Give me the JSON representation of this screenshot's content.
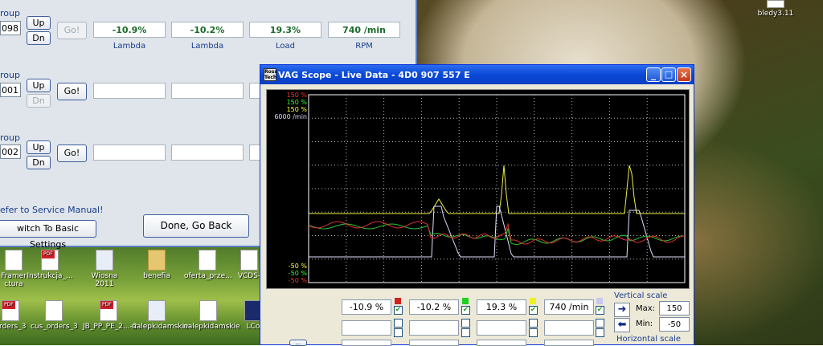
{
  "desktop": {
    "top_right_icon": {
      "label": "bledy3.11",
      "icon": "file-icon"
    },
    "icons": [
      {
        "label": "Framer\nctura",
        "icon": "document-icon"
      },
      {
        "label": "Instrukcja_...",
        "icon": "pdf-icon"
      },
      {
        "label": "Wiosna 2011",
        "icon": "odf-icon"
      },
      {
        "label": "benefia",
        "icon": "folder-icon"
      },
      {
        "label": "oferta_prze...",
        "icon": "document-icon"
      },
      {
        "label": "VCDS-",
        "icon": "shortcut-icon"
      },
      {
        "label": "orders_3",
        "icon": "pdf-icon"
      },
      {
        "label": "cus_orders_3",
        "icon": "document-icon"
      },
      {
        "label": "JB_PP_PE_2...-2",
        "icon": "pdf-icon"
      },
      {
        "label": "nalepkidamskie",
        "icon": "odf-icon"
      },
      {
        "label": "nalepkidamskie",
        "icon": "document-icon"
      },
      {
        "label": "LCo",
        "icon": "app-icon"
      }
    ]
  },
  "vcds": {
    "groups": [
      {
        "label": "roup",
        "number": "098",
        "up": "Up",
        "dn": "Dn",
        "go": "Go!",
        "go_disabled": true,
        "dn_disabled": false,
        "values": [
          "-10.9%",
          "-10.2%",
          "19.3%",
          "740 /min"
        ],
        "units": [
          "Lambda",
          "Lambda",
          "Load",
          "RPM"
        ]
      },
      {
        "label": "roup",
        "number": "001",
        "up": "Up",
        "dn": "Dn",
        "go": "Go!",
        "go_disabled": false,
        "dn_disabled": true,
        "values": [
          "",
          "",
          "",
          ""
        ],
        "units": [
          "",
          "",
          "",
          ""
        ]
      },
      {
        "label": "roup",
        "number": "002",
        "up": "Up",
        "dn": "Dn",
        "go": "Go!",
        "go_disabled": false,
        "dn_disabled": false,
        "values": [
          "",
          "",
          "",
          ""
        ],
        "units": [
          "",
          "",
          "",
          ""
        ]
      }
    ],
    "note": "efer to Service Manual!",
    "basic_settings_button": "witch To Basic Settings",
    "done_button": "Done, Go Back"
  },
  "scope": {
    "title": "VAG Scope  -  Live Data  -  4D0 907 557 E",
    "window_buttons": {
      "minimize": "_",
      "maximize": "□",
      "close": "×"
    },
    "axis_top": [
      {
        "text": "150 %",
        "color": "#ff3030"
      },
      {
        "text": "150 %",
        "color": "#30ff30"
      },
      {
        "text": "150 %",
        "color": "#ffff40"
      },
      {
        "text": "6000 /min",
        "color": "#d8d8ff"
      }
    ],
    "axis_bottom": [
      {
        "text": "-50 %",
        "color": "#ffff40"
      },
      {
        "text": "-50 %",
        "color": "#30ff30"
      },
      {
        "text": "-50 %",
        "color": "#ff3030"
      }
    ],
    "series_colors": {
      "red": "#e03030",
      "green": "#30c030",
      "yellow": "#f0f040",
      "white": "#e0e0ff"
    },
    "channels": [
      {
        "value": "-10.9 %",
        "swatch": "#d02020",
        "checked": true
      },
      {
        "value": "-10.2 %",
        "swatch": "#20d020",
        "checked": true
      },
      {
        "value": "19.3 %",
        "swatch": "#f0f020",
        "checked": true
      },
      {
        "value": "740 /min",
        "swatch": "#c8c8f0",
        "checked": true
      }
    ],
    "empty_channels": [
      "",
      "",
      "",
      ""
    ],
    "vertical_scale": {
      "title": "Vertical scale",
      "max_label": "Max:",
      "max_value": "150",
      "min_label": "Min:",
      "min_value": "-50"
    },
    "horizontal_scale": {
      "title": "Horizontal scale"
    },
    "bottom_left_button": "..."
  }
}
